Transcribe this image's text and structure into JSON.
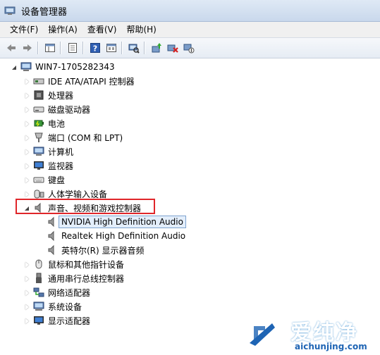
{
  "window": {
    "title": "设备管理器"
  },
  "menu": [
    "文件(F)",
    "操作(A)",
    "查看(V)",
    "帮助(H)"
  ],
  "toolbar": [
    "back-icon",
    "forward-icon",
    "show-hide-tree-icon",
    "properties-icon",
    "help-icon",
    "view-icon",
    "scan-hardware-icon",
    "update-driver-icon",
    "uninstall-icon",
    "disable-icon"
  ],
  "tree": {
    "root": "WIN7-1705282343",
    "categories": [
      {
        "label": "IDE ATA/ATAPI 控制器",
        "icon": "ide-icon"
      },
      {
        "label": "处理器",
        "icon": "cpu-icon"
      },
      {
        "label": "磁盘驱动器",
        "icon": "disk-icon"
      },
      {
        "label": "电池",
        "icon": "battery-icon"
      },
      {
        "label": "端口 (COM 和 LPT)",
        "icon": "port-icon"
      },
      {
        "label": "计算机",
        "icon": "computer-icon"
      },
      {
        "label": "监视器",
        "icon": "monitor-icon"
      },
      {
        "label": "键盘",
        "icon": "keyboard-icon"
      },
      {
        "label": "人体学输入设备",
        "icon": "hid-icon"
      },
      {
        "label": "声音、视频和游戏控制器",
        "icon": "speaker-icon",
        "expanded": true,
        "children": [
          "NVIDIA High Definition Audio",
          "Realtek High Definition Audio",
          "英特尔(R) 显示器音频"
        ]
      },
      {
        "label": "鼠标和其他指针设备",
        "icon": "mouse-icon"
      },
      {
        "label": "通用串行总线控制器",
        "icon": "usb-icon"
      },
      {
        "label": "网络适配器",
        "icon": "network-icon"
      },
      {
        "label": "系统设备",
        "icon": "system-icon"
      },
      {
        "label": "显示适配器",
        "icon": "display-icon"
      }
    ]
  },
  "watermark": {
    "brand": "爱纯净",
    "url": "aichunjing.com"
  }
}
